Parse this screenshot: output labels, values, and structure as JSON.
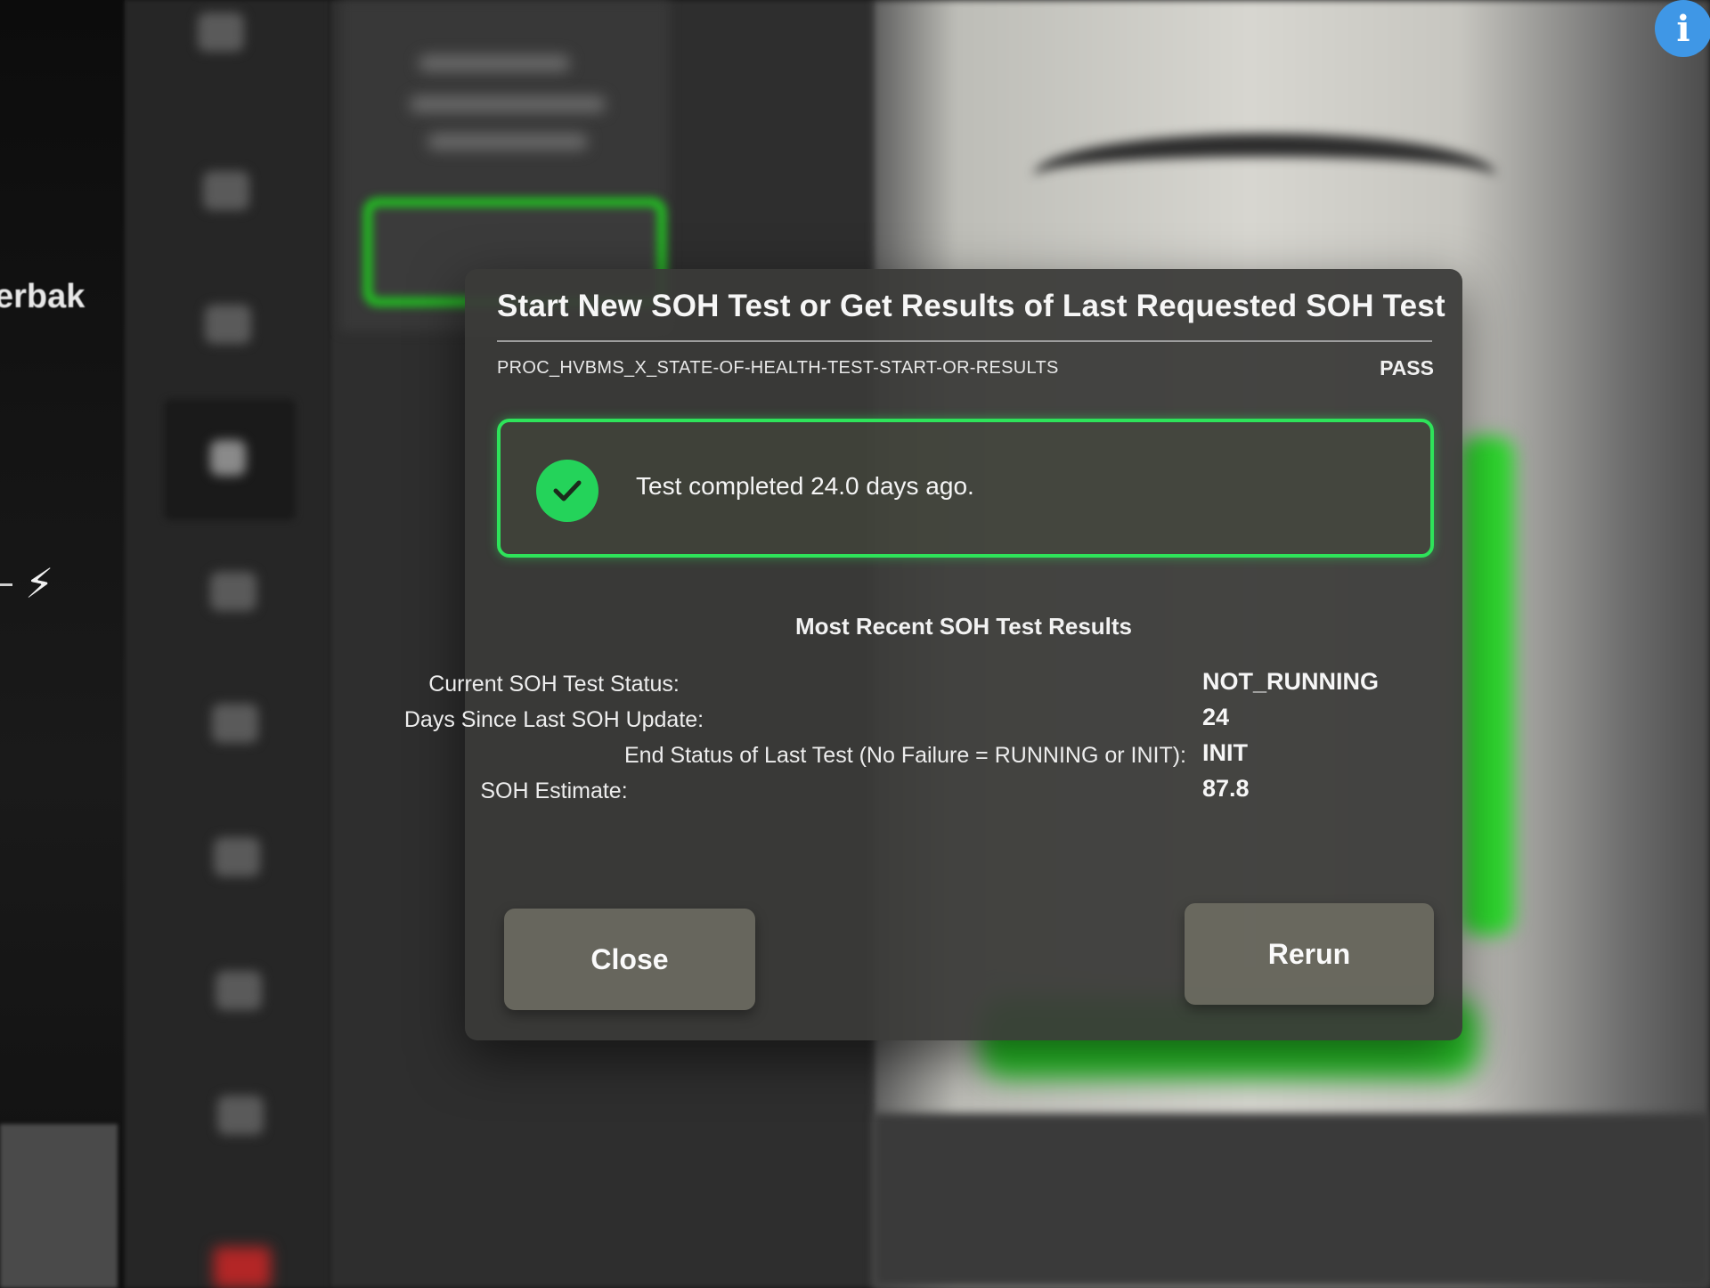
{
  "background": {
    "partial_label": "erbak",
    "bolt_icon": "lightning-bolt-icon",
    "info_icon": "info-icon",
    "info_glyph": "i"
  },
  "dialog": {
    "title": "Start New SOH Test or Get Results of Last Requested SOH Test",
    "procedure_id": "PROC_HVBMS_X_STATE-OF-HEALTH-TEST-START-OR-RESULTS",
    "procedure_result": "PASS",
    "status": {
      "icon": "check-circle-icon",
      "message": "Test completed 24.0 days ago.",
      "accent_color": "#2ee35a"
    },
    "results_heading": "Most Recent SOH Test Results",
    "results": [
      {
        "label": "Current SOH Test Status:",
        "value": "NOT_RUNNING"
      },
      {
        "label": "Days Since Last SOH Update:",
        "value": "24"
      },
      {
        "label": "End Status of Last Test (No Failure = RUNNING or INIT):",
        "value": "INIT"
      },
      {
        "label": "SOH Estimate:",
        "value": "87.8"
      }
    ],
    "buttons": {
      "close": "Close",
      "rerun": "Rerun"
    }
  }
}
